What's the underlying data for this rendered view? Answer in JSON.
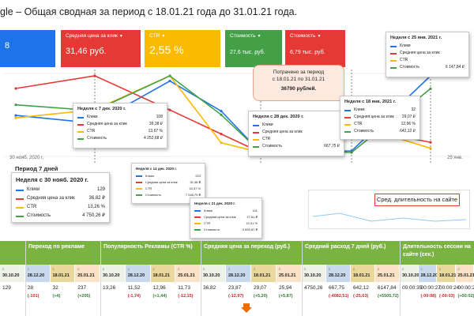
{
  "title": "gle – Общая сводная за период с 18.01.21 года до 31.01.21 года.",
  "kpis": [
    {
      "label": "",
      "value": "8",
      "color": "#1e73e8"
    },
    {
      "label": "Средняя цена за клик",
      "value": "31,46 руб.",
      "color": "#e53935"
    },
    {
      "label": "CTR",
      "value": "2,55 %",
      "color": "#fbba00"
    },
    {
      "label": "Стоимость",
      "value": "27,6 тыс. руб.",
      "color": "#43a047"
    },
    {
      "label": "Стоимость",
      "value": "6,79 тыс. руб.",
      "color": "#e53935"
    }
  ],
  "kpi_caret": "▼",
  "colors": {
    "clicks": "#1e73e8",
    "cpc": "#e53935",
    "ctr": "#fbba00",
    "cost": "#43a047",
    "header_green": "#7bb342",
    "callout": "#fde9df"
  },
  "metric_labels": {
    "clicks": "Клики",
    "cpc": "Средняя цена за клик",
    "ctr": "CTR",
    "cost": "Стоимость"
  },
  "cards": [
    {
      "id": "jan25",
      "header": "Неделя с 25 янв. 2021 г.",
      "values": [
        "",
        "",
        "",
        "6 147,84 ₽"
      ]
    },
    {
      "id": "dec7",
      "header": "Неделя с 7 дек. 2020 г.",
      "values": [
        "108",
        "39,38 ₽",
        "13,67 %",
        "4 252,68 ₽"
      ]
    },
    {
      "id": "dec28a",
      "header": "Неделя с 28 дек. 2020 г.",
      "values": [
        "",
        "",
        "",
        "667,75 ₽"
      ]
    },
    {
      "id": "jan18",
      "header": "Неделя с 18 янв. 2021 г.",
      "values": [
        "32",
        "29,07 ₽",
        "12,96 %",
        "642,12 ₽"
      ]
    },
    {
      "id": "nov30",
      "header": "Неделя с 30 нояб. 2020 г.",
      "values": [
        "129",
        "36,82 ₽",
        "13,26 %",
        "4 750,26 ₽"
      ]
    },
    {
      "id": "dec14",
      "header": "Неделя с 14 дек. 2020 г.",
      "values": [
        "223",
        "32,48 ₽",
        "15,37 %",
        "7 248,79 ₽"
      ]
    },
    {
      "id": "dec21",
      "header": "Неделя с 21 дек. 2020 г.",
      "values": [
        "141",
        "27,61 ₽",
        "12,01 %",
        "3 893,87 ₽"
      ]
    }
  ],
  "callout": {
    "line1": "Потрачено за  период",
    "line2": "с 18.01.21 по 31.01.21",
    "sum": "36790 рублей."
  },
  "period_label": "Период 7 дней",
  "x_labels": {
    "left": "30 нояб. 2020 г.",
    "right": "25 янв."
  },
  "time_box": "Сред. длительность на сайте",
  "table": {
    "headers": [
      "",
      "Переход по рекламе",
      "Популярность Рекламы (CTR %)",
      "Средняя цена за переход (руб.)",
      "Средний расход 7 дней (руб.)",
      "Длительность сессии на сайте (сек.)"
    ],
    "date_prefix": "с",
    "dates": [
      "30.10.20",
      "28.12.20",
      "18.01.21",
      "25.01.21"
    ],
    "dates_short": [
      "30.10.20",
      "28.12.20",
      "18.01.21",
      "25.01.21"
    ],
    "values": [
      "129",
      "28",
      "32",
      "237",
      "13,26",
      "11,52",
      "12,96",
      "11,73",
      "36,82",
      "23,87",
      "29,07",
      "25,94",
      "4750,26",
      "667,75",
      "642,12",
      "6147,84",
      "00:00:35",
      "00:00:27",
      "00:00:24",
      "00:00:26"
    ],
    "deltas": [
      "",
      "(-101)",
      "(+4)",
      "(+205)",
      "",
      "(-1,74)",
      "(+1,44)",
      "(-12,15)",
      "",
      "(-12,97)",
      "(+5,20)",
      "(+5,87)",
      "",
      "(-4082,51)",
      "(-25,63)",
      "(+5505,72)",
      "",
      "(-00:08)",
      "(-00:03)",
      "(+00:02)"
    ]
  },
  "chart_data": {
    "type": "line",
    "x": [
      "30 нояб. 2020 г.",
      "7 дек. 2020 г.",
      "14 дек. 2020 г.",
      "21 дек. 2020 г.",
      "28 дек. 2020 г.",
      "18 янв. 2021 г.",
      "25 янв. 2021 г."
    ],
    "series": [
      {
        "name": "Клики",
        "values": [
          129,
          108,
          223,
          141,
          28,
          32,
          237
        ]
      },
      {
        "name": "Средняя цена за клик",
        "values": [
          36.82,
          39.38,
          32.48,
          27.61,
          23.87,
          29.07,
          25.94
        ]
      },
      {
        "name": "CTR",
        "values": [
          13.26,
          13.67,
          15.37,
          12.01,
          11.52,
          12.96,
          11.73
        ]
      },
      {
        "name": "Стоимость",
        "values": [
          4750.26,
          4252.68,
          7248.79,
          3893.87,
          667.75,
          642.12,
          6147.84
        ]
      }
    ],
    "grid": false
  }
}
